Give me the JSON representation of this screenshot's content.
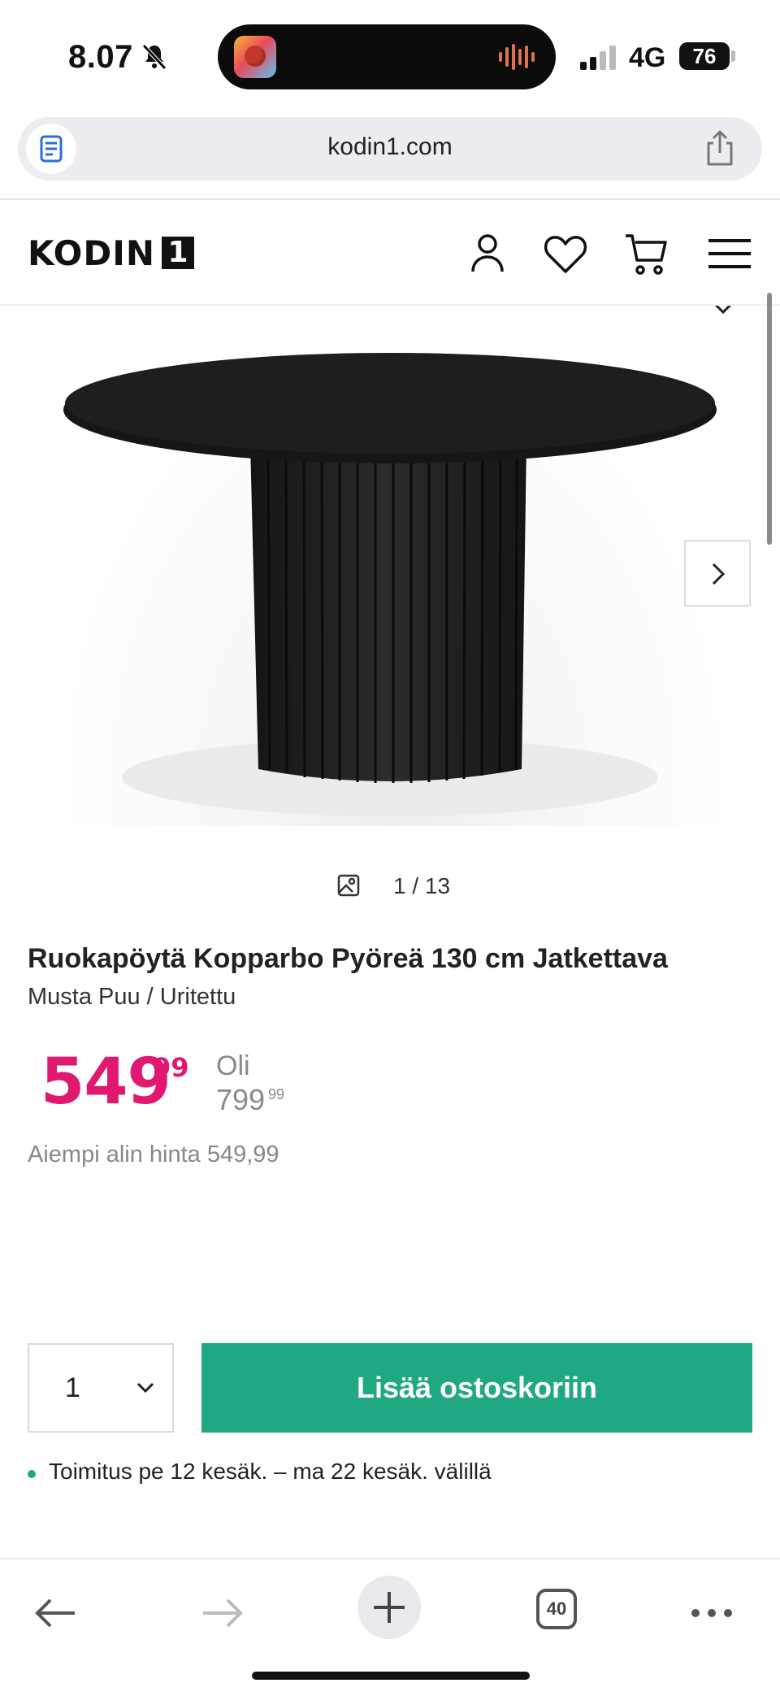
{
  "status_bar": {
    "time": "8.07",
    "network": "4G",
    "battery": "76"
  },
  "browser": {
    "url": "kodin1.com",
    "tab_count": "40"
  },
  "site": {
    "logo_text": "KODIN",
    "logo_number": "1"
  },
  "gallery": {
    "counter": "1 / 13"
  },
  "product": {
    "title": "Ruokapöytä Kopparbo Pyöreä 130 cm Jatkettava",
    "subtitle": "Musta Puu / Uritettu",
    "price_main": "549",
    "price_cents": "99",
    "was_label": "Oli",
    "was_price": "799",
    "was_cents": "99",
    "previous_lowest": "Aiempi alin hinta 549,99"
  },
  "cart": {
    "quantity": "1",
    "add_label": "Lisää ostoskoriin",
    "delivery": "Toimitus pe 12 kesäk. – ma 22 kesäk. välillä"
  },
  "colors": {
    "price": "#e0186f",
    "accent_green": "#1fa882"
  }
}
